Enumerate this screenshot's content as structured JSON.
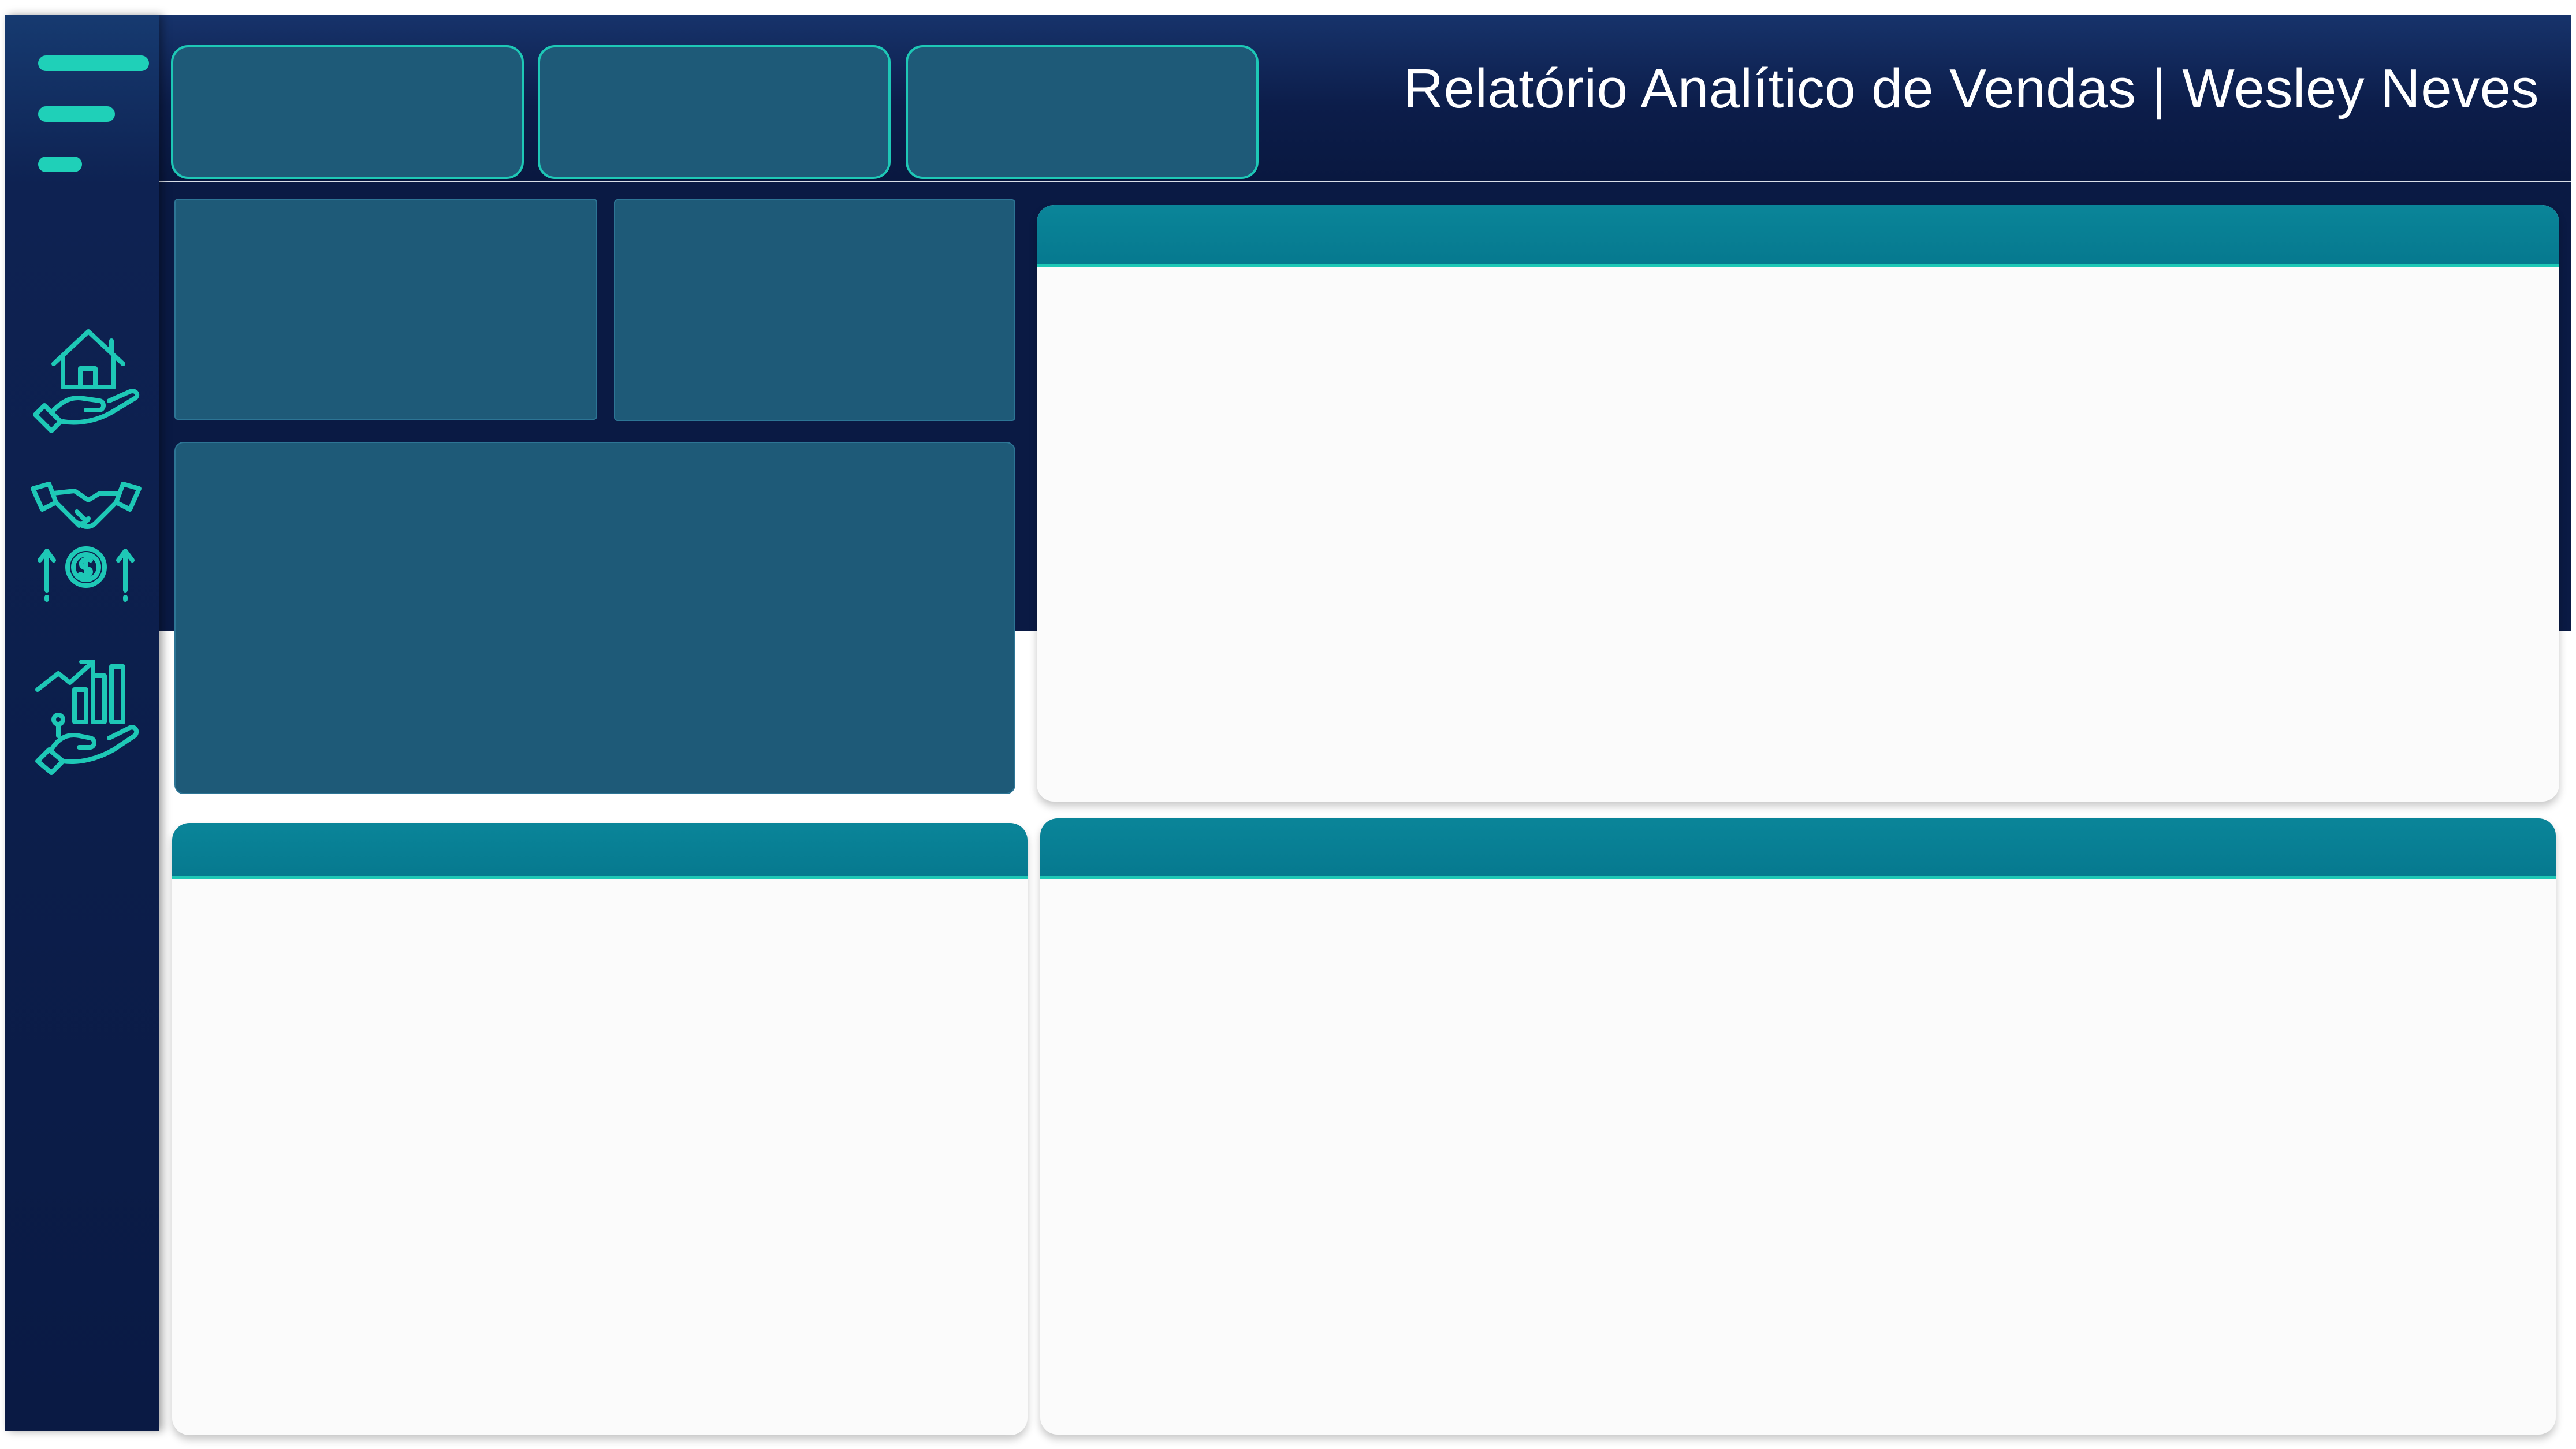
{
  "header": {
    "title": "Relatório Analítico de Vendas | Wesley Neves"
  },
  "sidebar": {
    "menu_icon": "hamburger-menu-icon",
    "items": [
      {
        "icon": "house-in-hand-icon"
      },
      {
        "icon": "handshake-dollar-icon"
      },
      {
        "icon": "growth-chart-hand-icon"
      }
    ]
  },
  "filters": [
    {
      "name": "filter-slot-1",
      "label": ""
    },
    {
      "name": "filter-slot-2",
      "label": ""
    },
    {
      "name": "filter-slot-3",
      "label": ""
    }
  ],
  "panels": {
    "top_right": {
      "title": ""
    },
    "bottom_left": {
      "title": ""
    },
    "bottom_right": {
      "title": ""
    }
  },
  "colors": {
    "navy": "#0a1a44",
    "teal_accent": "#1ec8b6",
    "card_blue": "#1e5a78",
    "panel_header": "#06798f",
    "panel_bg": "#fbfbfb"
  }
}
